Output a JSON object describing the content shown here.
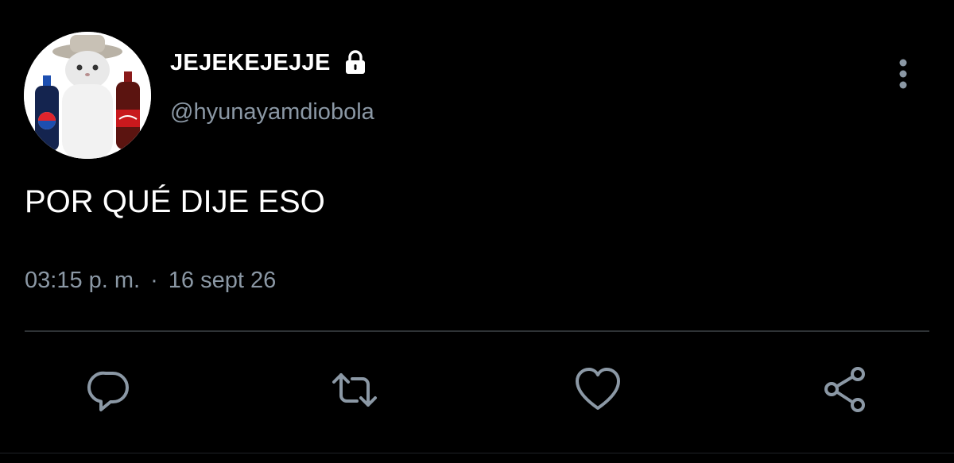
{
  "user": {
    "display_name": "JEJEKEJEJJE",
    "handle": "@hyunayamdiobola",
    "protected": true
  },
  "tweet": {
    "text": "POR QUÉ DIJE ESO",
    "time": "03:15 p. m.",
    "separator": "·",
    "date": "16 sept 26"
  },
  "icons": {
    "avatar": "cat-with-soda-bottles-avatar",
    "lock": "lock-icon",
    "more": "more-vertical-icon",
    "reply": "reply-icon",
    "retweet": "retweet-icon",
    "like": "heart-icon",
    "share": "share-icon"
  },
  "colors": {
    "background": "#000000",
    "primary_text": "#ffffff",
    "secondary_text": "#8b98a5",
    "divider": "#2f3336"
  }
}
